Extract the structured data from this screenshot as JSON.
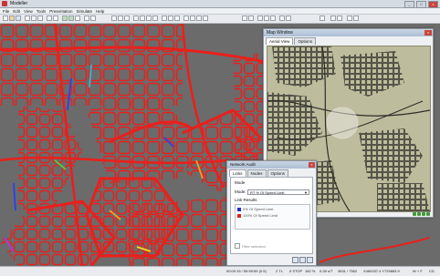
{
  "app": {
    "title": "Modeller"
  },
  "window_controls": {
    "minimize": "_",
    "maximize": "□",
    "close": "x"
  },
  "menu": [
    "File",
    "Edit",
    "View",
    "Tools",
    "Presentation",
    "Simulate",
    "Help"
  ],
  "colors": {
    "network_link": "#e8201c",
    "map_background": "#bdbc9c",
    "canvas": "#6b6b6b"
  },
  "map_window": {
    "title": "Map Window",
    "tabs": [
      "Aerial View",
      "Options"
    ]
  },
  "network_audit": {
    "title": "Network Audit",
    "tabs": [
      "Links",
      "Nodes",
      "Options"
    ],
    "mode_section_label": "Mode",
    "mode_label": "Mode:",
    "mode_value": "RT % Of Speed Limit",
    "link_results_label": "Link Results",
    "legend": [
      {
        "label": "0% Of Speed Limit",
        "color": "#1f2bd6"
      },
      {
        "label": "100% Of Speed Limit",
        "color": "#e0201c"
      }
    ],
    "filter_label": "Filter selection"
  },
  "status": {
    "time": "00:00:15 / 59:59:59 (0.5)",
    "fields": [
      "2 TL",
      "0 STOP",
      "182 %",
      "0.28 s/T",
      "3831 / 7552",
      "X460337.4 Y725883.9",
      "W + F",
      "CD"
    ]
  }
}
